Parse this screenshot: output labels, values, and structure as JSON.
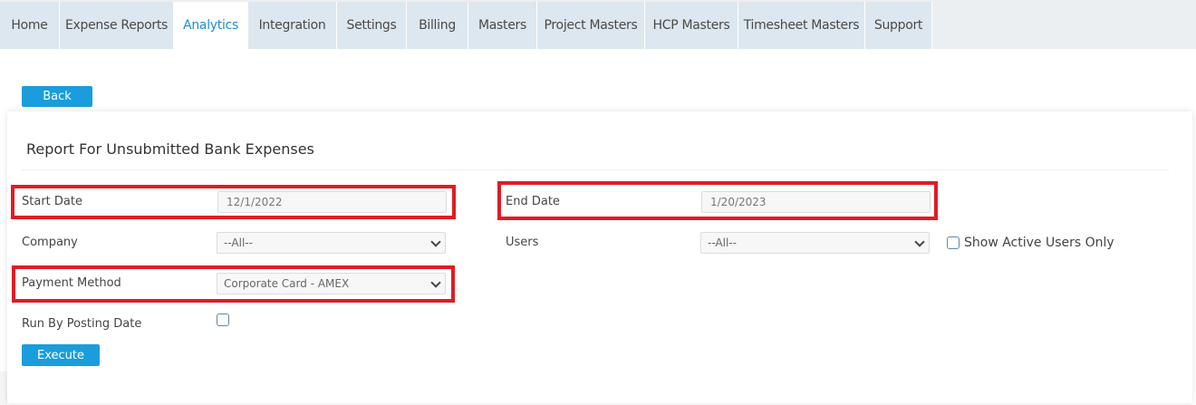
{
  "tabs": [
    {
      "label": "Home",
      "active": false
    },
    {
      "label": "Expense Reports",
      "active": false
    },
    {
      "label": "Analytics",
      "active": true
    },
    {
      "label": "Integration",
      "active": false
    },
    {
      "label": "Settings",
      "active": false
    },
    {
      "label": "Billing",
      "active": false
    },
    {
      "label": "Masters",
      "active": false
    },
    {
      "label": "Project Masters",
      "active": false
    },
    {
      "label": "HCP Masters",
      "active": false
    },
    {
      "label": "Timesheet Masters",
      "active": false
    },
    {
      "label": "Support",
      "active": false
    }
  ],
  "back_label": "Back",
  "report": {
    "title": "Report For Unsubmitted Bank Expenses",
    "start_date": {
      "label": "Start Date",
      "value": "12/1/2022"
    },
    "end_date": {
      "label": "End Date",
      "value": "1/20/2023"
    },
    "company": {
      "label": "Company",
      "selected": "--All--"
    },
    "users": {
      "label": "Users",
      "selected": "--All--"
    },
    "show_active": {
      "label": "Show Active Users Only",
      "checked": false
    },
    "payment_method": {
      "label": "Payment Method",
      "selected": "Corporate Card - AMEX"
    },
    "run_by_posting": {
      "label": "Run By Posting Date",
      "checked": false
    },
    "execute_label": "Execute"
  },
  "colors": {
    "accent": "#1a9ddc",
    "active_tab_text": "#1f8dd6",
    "tab_bg": "#dde7ef",
    "highlight": "#e01c24"
  }
}
